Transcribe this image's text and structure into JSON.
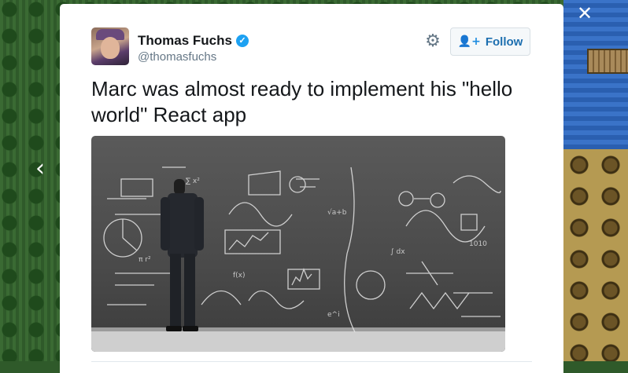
{
  "navigation": {
    "prev_icon": "chevron-left-icon",
    "prev_glyph": "‹",
    "close_icon": "close-icon",
    "close_glyph": "✕"
  },
  "tweet": {
    "author_name": "Thomas Fuchs",
    "verified_glyph": "✓",
    "handle": "@thomasfuchs",
    "text": "Marc was almost ready to implement his \"hello world\" React app",
    "settings_glyph": "⚙",
    "follow": {
      "label": "Follow",
      "icon": "add-user-icon",
      "glyph": "👤+"
    }
  },
  "colors": {
    "accent": "#1da1f2",
    "follow_text": "#1d6fb0",
    "text_primary": "#14171a",
    "text_secondary": "#657786"
  }
}
